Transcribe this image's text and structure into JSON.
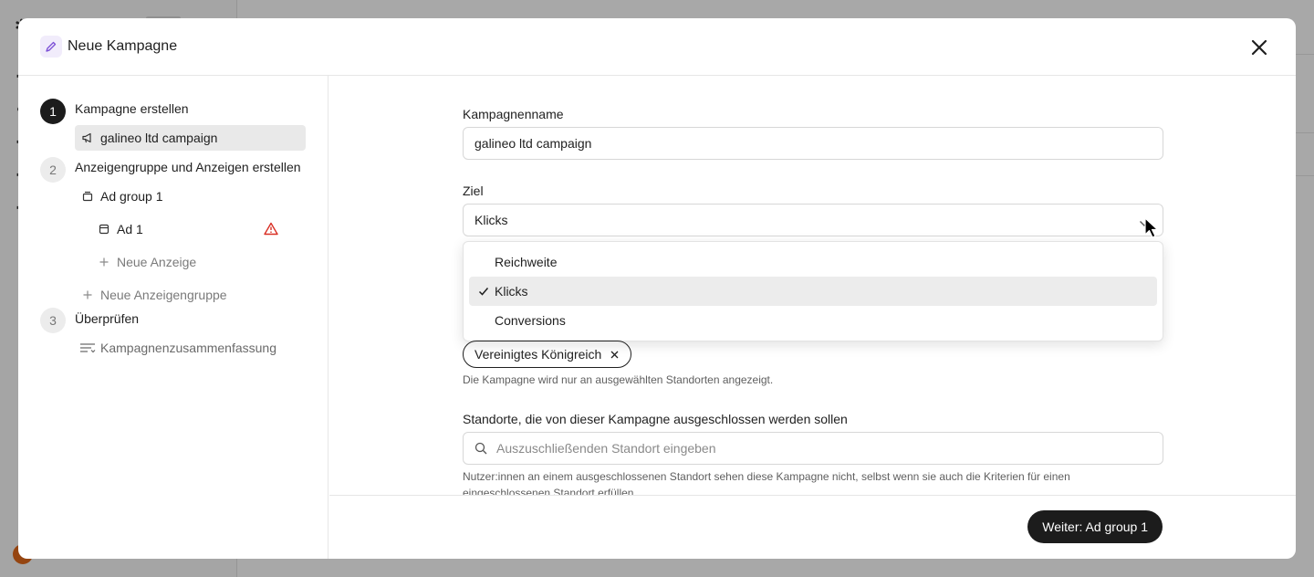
{
  "modal": {
    "title": "Neue Kampagne",
    "close_icon": "close-icon"
  },
  "steps": [
    {
      "number": "1",
      "label": "Kampagne erstellen"
    },
    {
      "number": "2",
      "label": "Anzeigengruppe und Anzeigen erstellen"
    },
    {
      "number": "3",
      "label": "Überprüfen"
    }
  ],
  "tree": {
    "campaign": "galineo ltd campaign",
    "ad_group": "Ad group 1",
    "ad": "Ad 1",
    "new_ad": "Neue Anzeige",
    "new_ad_group": "Neue Anzeigengruppe",
    "summary": "Kampagnenzusammenfassung"
  },
  "form": {
    "name_label": "Kampagnenname",
    "name_value": "galineo ltd campaign",
    "goal_label": "Ziel",
    "goal_value": "Klicks",
    "goal_options": [
      {
        "label": "Reichweite"
      },
      {
        "label": "Klicks"
      },
      {
        "label": "Conversions"
      }
    ],
    "location_chip": "Vereinigtes Königreich",
    "location_hint": "Die Kampagne wird nur an ausgewählten Standorten angezeigt.",
    "exclude_label": "Standorte, die von dieser Kampagne ausgeschlossen werden sollen",
    "exclude_placeholder": "Auszuschließenden Standort eingeben",
    "exclude_hint": "Nutzer:innen an einem ausgeschlossenen Standort sehen diese Kampagne nicht, selbst wenn sie auch die Kriterien für einen eingeschlossenen Standort erfüllen."
  },
  "footer": {
    "next_label": "Weiter: Ad group 1"
  },
  "colors": {
    "accent_dark": "#1c1c1c",
    "warning": "#d93025",
    "title_icon_bg": "#f1ecfb",
    "title_icon_fg": "#7b4fd6"
  }
}
